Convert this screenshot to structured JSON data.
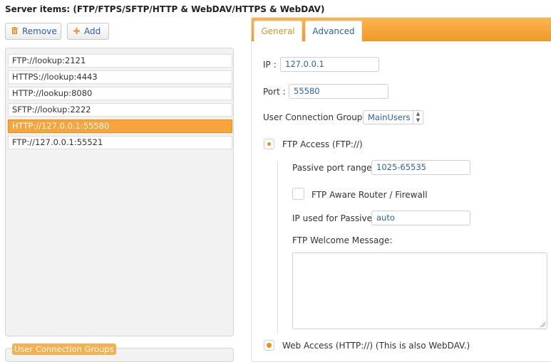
{
  "header": {
    "title": "Server items: (FTP/FTPS/SFTP/HTTP & WebDAV/HTTPS & WebDAV)"
  },
  "toolbar": {
    "remove_label": "Remove",
    "remove_icon": "trash-icon",
    "add_label": "Add",
    "add_icon": "plus-icon"
  },
  "server_list": {
    "items": [
      {
        "label": "FTP://lookup:2121",
        "selected": false
      },
      {
        "label": "HTTPS://lookup:4443",
        "selected": false
      },
      {
        "label": "HTTP://lookup:8080",
        "selected": false
      },
      {
        "label": "SFTP://lookup:2222",
        "selected": false
      },
      {
        "label": "HTTP://127.0.0.1:55580",
        "selected": true
      },
      {
        "label": "FTP://127.0.0.1:55521",
        "selected": false
      }
    ]
  },
  "groups_section": {
    "label": "User Connection Groups"
  },
  "tabs": [
    {
      "label": "General",
      "active": true
    },
    {
      "label": "Advanced",
      "active": false
    }
  ],
  "general": {
    "ip_label": "IP :",
    "ip_value": "127.0.0.1",
    "port_label": "Port :",
    "port_value": "55580",
    "groups_label": "User Connection Groups",
    "groups_value": "MainUsers",
    "ftp_access_label": "FTP Access (FTP://)",
    "passive_range_label": "Passive port range:",
    "passive_range_value": "1025-65535",
    "ftp_aware_label": "FTP Aware Router / Firewall",
    "passive_ip_label": "IP used for Passive:",
    "passive_ip_value": "auto",
    "welcome_label": "FTP Welcome Message:",
    "welcome_value": "",
    "web_access_label": "Web Access (HTTP://) (This is also WebDAV.)"
  },
  "colors": {
    "accent": "#f09a27",
    "link": "#2a63a8",
    "selected_bg": "#f7a53a"
  }
}
